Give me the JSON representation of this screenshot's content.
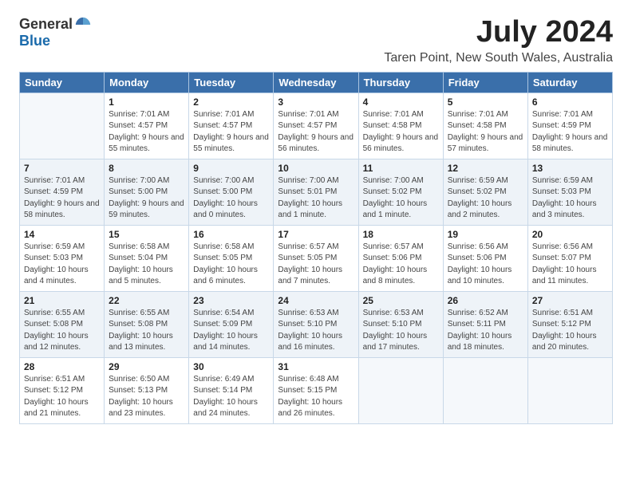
{
  "logo": {
    "general": "General",
    "blue": "Blue"
  },
  "title": "July 2024",
  "location": "Taren Point, New South Wales, Australia",
  "headers": [
    "Sunday",
    "Monday",
    "Tuesday",
    "Wednesday",
    "Thursday",
    "Friday",
    "Saturday"
  ],
  "weeks": [
    [
      {
        "day": "",
        "sunrise": "",
        "sunset": "",
        "daylight": ""
      },
      {
        "day": "1",
        "sunrise": "Sunrise: 7:01 AM",
        "sunset": "Sunset: 4:57 PM",
        "daylight": "Daylight: 9 hours and 55 minutes."
      },
      {
        "day": "2",
        "sunrise": "Sunrise: 7:01 AM",
        "sunset": "Sunset: 4:57 PM",
        "daylight": "Daylight: 9 hours and 55 minutes."
      },
      {
        "day": "3",
        "sunrise": "Sunrise: 7:01 AM",
        "sunset": "Sunset: 4:57 PM",
        "daylight": "Daylight: 9 hours and 56 minutes."
      },
      {
        "day": "4",
        "sunrise": "Sunrise: 7:01 AM",
        "sunset": "Sunset: 4:58 PM",
        "daylight": "Daylight: 9 hours and 56 minutes."
      },
      {
        "day": "5",
        "sunrise": "Sunrise: 7:01 AM",
        "sunset": "Sunset: 4:58 PM",
        "daylight": "Daylight: 9 hours and 57 minutes."
      },
      {
        "day": "6",
        "sunrise": "Sunrise: 7:01 AM",
        "sunset": "Sunset: 4:59 PM",
        "daylight": "Daylight: 9 hours and 58 minutes."
      }
    ],
    [
      {
        "day": "7",
        "sunrise": "Sunrise: 7:01 AM",
        "sunset": "Sunset: 4:59 PM",
        "daylight": "Daylight: 9 hours and 58 minutes."
      },
      {
        "day": "8",
        "sunrise": "Sunrise: 7:00 AM",
        "sunset": "Sunset: 5:00 PM",
        "daylight": "Daylight: 9 hours and 59 minutes."
      },
      {
        "day": "9",
        "sunrise": "Sunrise: 7:00 AM",
        "sunset": "Sunset: 5:00 PM",
        "daylight": "Daylight: 10 hours and 0 minutes."
      },
      {
        "day": "10",
        "sunrise": "Sunrise: 7:00 AM",
        "sunset": "Sunset: 5:01 PM",
        "daylight": "Daylight: 10 hours and 1 minute."
      },
      {
        "day": "11",
        "sunrise": "Sunrise: 7:00 AM",
        "sunset": "Sunset: 5:02 PM",
        "daylight": "Daylight: 10 hours and 1 minute."
      },
      {
        "day": "12",
        "sunrise": "Sunrise: 6:59 AM",
        "sunset": "Sunset: 5:02 PM",
        "daylight": "Daylight: 10 hours and 2 minutes."
      },
      {
        "day": "13",
        "sunrise": "Sunrise: 6:59 AM",
        "sunset": "Sunset: 5:03 PM",
        "daylight": "Daylight: 10 hours and 3 minutes."
      }
    ],
    [
      {
        "day": "14",
        "sunrise": "Sunrise: 6:59 AM",
        "sunset": "Sunset: 5:03 PM",
        "daylight": "Daylight: 10 hours and 4 minutes."
      },
      {
        "day": "15",
        "sunrise": "Sunrise: 6:58 AM",
        "sunset": "Sunset: 5:04 PM",
        "daylight": "Daylight: 10 hours and 5 minutes."
      },
      {
        "day": "16",
        "sunrise": "Sunrise: 6:58 AM",
        "sunset": "Sunset: 5:05 PM",
        "daylight": "Daylight: 10 hours and 6 minutes."
      },
      {
        "day": "17",
        "sunrise": "Sunrise: 6:57 AM",
        "sunset": "Sunset: 5:05 PM",
        "daylight": "Daylight: 10 hours and 7 minutes."
      },
      {
        "day": "18",
        "sunrise": "Sunrise: 6:57 AM",
        "sunset": "Sunset: 5:06 PM",
        "daylight": "Daylight: 10 hours and 8 minutes."
      },
      {
        "day": "19",
        "sunrise": "Sunrise: 6:56 AM",
        "sunset": "Sunset: 5:06 PM",
        "daylight": "Daylight: 10 hours and 10 minutes."
      },
      {
        "day": "20",
        "sunrise": "Sunrise: 6:56 AM",
        "sunset": "Sunset: 5:07 PM",
        "daylight": "Daylight: 10 hours and 11 minutes."
      }
    ],
    [
      {
        "day": "21",
        "sunrise": "Sunrise: 6:55 AM",
        "sunset": "Sunset: 5:08 PM",
        "daylight": "Daylight: 10 hours and 12 minutes."
      },
      {
        "day": "22",
        "sunrise": "Sunrise: 6:55 AM",
        "sunset": "Sunset: 5:08 PM",
        "daylight": "Daylight: 10 hours and 13 minutes."
      },
      {
        "day": "23",
        "sunrise": "Sunrise: 6:54 AM",
        "sunset": "Sunset: 5:09 PM",
        "daylight": "Daylight: 10 hours and 14 minutes."
      },
      {
        "day": "24",
        "sunrise": "Sunrise: 6:53 AM",
        "sunset": "Sunset: 5:10 PM",
        "daylight": "Daylight: 10 hours and 16 minutes."
      },
      {
        "day": "25",
        "sunrise": "Sunrise: 6:53 AM",
        "sunset": "Sunset: 5:10 PM",
        "daylight": "Daylight: 10 hours and 17 minutes."
      },
      {
        "day": "26",
        "sunrise": "Sunrise: 6:52 AM",
        "sunset": "Sunset: 5:11 PM",
        "daylight": "Daylight: 10 hours and 18 minutes."
      },
      {
        "day": "27",
        "sunrise": "Sunrise: 6:51 AM",
        "sunset": "Sunset: 5:12 PM",
        "daylight": "Daylight: 10 hours and 20 minutes."
      }
    ],
    [
      {
        "day": "28",
        "sunrise": "Sunrise: 6:51 AM",
        "sunset": "Sunset: 5:12 PM",
        "daylight": "Daylight: 10 hours and 21 minutes."
      },
      {
        "day": "29",
        "sunrise": "Sunrise: 6:50 AM",
        "sunset": "Sunset: 5:13 PM",
        "daylight": "Daylight: 10 hours and 23 minutes."
      },
      {
        "day": "30",
        "sunrise": "Sunrise: 6:49 AM",
        "sunset": "Sunset: 5:14 PM",
        "daylight": "Daylight: 10 hours and 24 minutes."
      },
      {
        "day": "31",
        "sunrise": "Sunrise: 6:48 AM",
        "sunset": "Sunset: 5:15 PM",
        "daylight": "Daylight: 10 hours and 26 minutes."
      },
      {
        "day": "",
        "sunrise": "",
        "sunset": "",
        "daylight": ""
      },
      {
        "day": "",
        "sunrise": "",
        "sunset": "",
        "daylight": ""
      },
      {
        "day": "",
        "sunrise": "",
        "sunset": "",
        "daylight": ""
      }
    ]
  ]
}
